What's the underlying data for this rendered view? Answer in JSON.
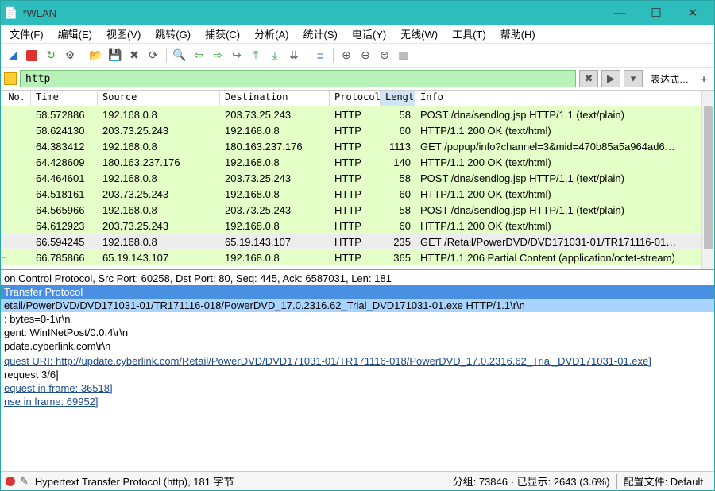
{
  "window": {
    "title": "*WLAN"
  },
  "menu": [
    "文件(F)",
    "编辑(E)",
    "视图(V)",
    "跳转(G)",
    "捕获(C)",
    "分析(A)",
    "统计(S)",
    "电话(Y)",
    "无线(W)",
    "工具(T)",
    "帮助(H)"
  ],
  "filter": {
    "value": "http",
    "expr_label": "表达式…"
  },
  "columns": {
    "no": "No.",
    "time": "Time",
    "source": "Source",
    "destination": "Destination",
    "protocol": "Protocol",
    "length": "Length",
    "info": "Info"
  },
  "rows": [
    {
      "no": "",
      "time": "58.572886",
      "src": "192.168.0.8",
      "dst": "203.73.25.243",
      "proto": "HTTP",
      "len": "58",
      "info": "POST /dna/sendlog.jsp HTTP/1.1  (text/plain)"
    },
    {
      "no": "",
      "time": "58.624130",
      "src": "203.73.25.243",
      "dst": "192.168.0.8",
      "proto": "HTTP",
      "len": "60",
      "info": "HTTP/1.1 200 OK  (text/html)"
    },
    {
      "no": "",
      "time": "64.383412",
      "src": "192.168.0.8",
      "dst": "180.163.237.176",
      "proto": "HTTP",
      "len": "1113",
      "info": "GET /popup/info?channel=3&mid=470b85a5a964ad6…"
    },
    {
      "no": "",
      "time": "64.428609",
      "src": "180.163.237.176",
      "dst": "192.168.0.8",
      "proto": "HTTP",
      "len": "140",
      "info": "HTTP/1.1 200 OK  (text/html)"
    },
    {
      "no": "",
      "time": "64.464601",
      "src": "192.168.0.8",
      "dst": "203.73.25.243",
      "proto": "HTTP",
      "len": "58",
      "info": "POST /dna/sendlog.jsp HTTP/1.1  (text/plain)"
    },
    {
      "no": "",
      "time": "64.518161",
      "src": "203.73.25.243",
      "dst": "192.168.0.8",
      "proto": "HTTP",
      "len": "60",
      "info": "HTTP/1.1 200 OK  (text/html)"
    },
    {
      "no": "",
      "time": "64.565966",
      "src": "192.168.0.8",
      "dst": "203.73.25.243",
      "proto": "HTTP",
      "len": "58",
      "info": "POST /dna/sendlog.jsp HTTP/1.1  (text/plain)"
    },
    {
      "no": "",
      "time": "64.612923",
      "src": "203.73.25.243",
      "dst": "192.168.0.8",
      "proto": "HTTP",
      "len": "60",
      "info": "HTTP/1.1 200 OK  (text/html)"
    },
    {
      "no": "",
      "time": "66.594245",
      "src": "192.168.0.8",
      "dst": "65.19.143.107",
      "proto": "HTTP",
      "len": "235",
      "info": "GET /Retail/PowerDVD/DVD171031-01/TR171116-01…",
      "sel": true,
      "arrow": "right"
    },
    {
      "no": "",
      "time": "66.785866",
      "src": "65.19.143.107",
      "dst": "192.168.0.8",
      "proto": "HTTP",
      "len": "365",
      "info": "HTTP/1.1 206 Partial Content  (application/octet-stream)",
      "arrow": "left"
    }
  ],
  "details": [
    {
      "t": "on Control Protocol, Src Port: 60258, Dst Port: 80, Seq: 445, Ack: 6587031, Len: 181"
    },
    {
      "t": "Transfer Protocol",
      "cls": "hl"
    },
    {
      "t": "etail/PowerDVD/DVD171031-01/TR171116-018/PowerDVD_17.0.2316.62_Trial_DVD171031-01.exe HTTP/1.1\\r\\n",
      "cls": "hl2"
    },
    {
      "t": ": bytes=0-1\\r\\n"
    },
    {
      "t": "gent: WinINetPost/0.0.4\\r\\n"
    },
    {
      "t": "pdate.cyberlink.com\\r\\n"
    },
    {
      "t": " "
    },
    {
      "t": "quest URI: http://update.cyberlink.com/Retail/PowerDVD/DVD171031-01/TR171116-018/PowerDVD_17.0.2316.62_Trial_DVD171031-01.exe]",
      "cls": "link"
    },
    {
      "t": "request 3/6]"
    },
    {
      "t": "equest in frame: 36518]",
      "cls": "link"
    },
    {
      "t": "nse in frame: 69952]",
      "cls": "link"
    }
  ],
  "status": {
    "proto": "Hypertext Transfer Protocol (http), 181 字节",
    "pkts": "分组: 73846 · 已显示: 2643 (3.6%)",
    "profile": "配置文件: Default"
  }
}
